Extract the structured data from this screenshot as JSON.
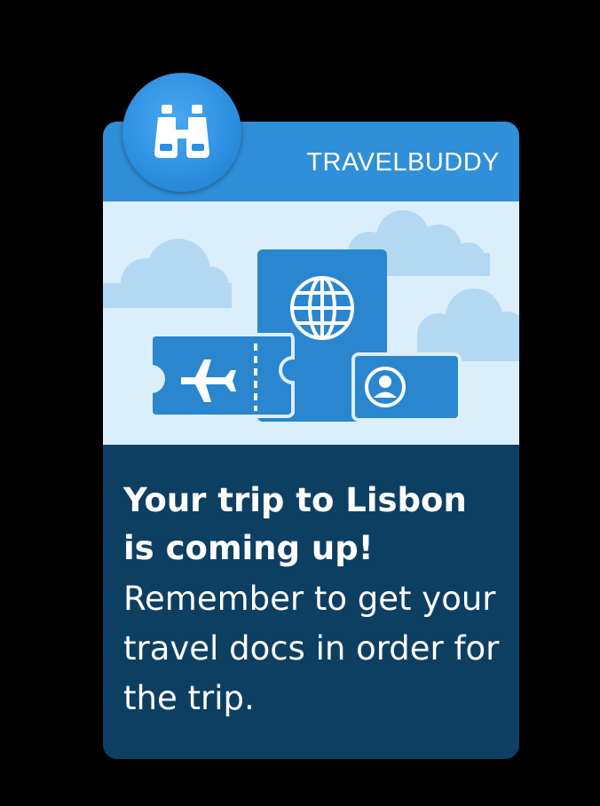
{
  "notification": {
    "app_name": "TRAVELBUDDY",
    "title": "Your trip to Lisbon is coming up!",
    "message": "Remember to get your travel docs in order for the trip."
  },
  "icons": {
    "app_icon": "binoculars-icon",
    "illustration": [
      "cloud-icon",
      "plane-ticket-icon",
      "passport-globe-icon",
      "id-card-icon"
    ]
  },
  "colors": {
    "background": "#000000",
    "header": "#2f8fd8",
    "illustration_bg": "#dbeefb",
    "body_bg": "#0d3f63",
    "illustration_blue": "#2a86cf",
    "cloud": "#b3d8f2"
  }
}
